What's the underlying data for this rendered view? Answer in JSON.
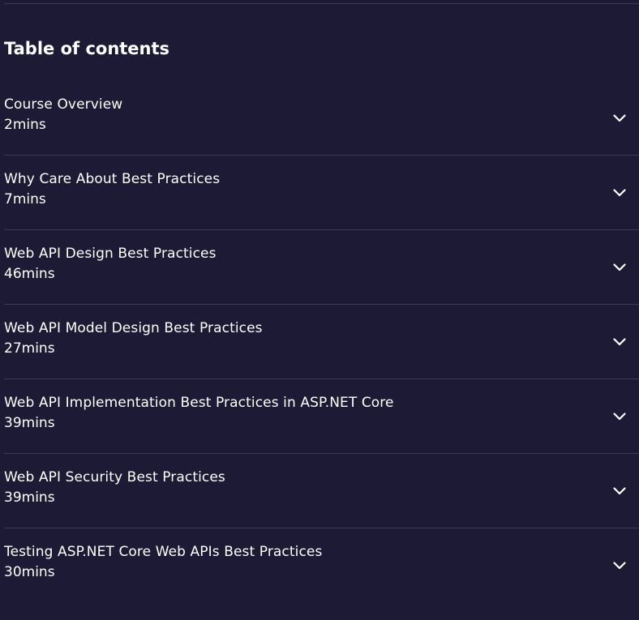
{
  "toc": {
    "title": "Table of contents",
    "items": [
      {
        "title": "Course Overview",
        "duration": "2mins"
      },
      {
        "title": "Why Care About Best Practices",
        "duration": "7mins"
      },
      {
        "title": "Web API Design Best Practices",
        "duration": "46mins"
      },
      {
        "title": "Web API Model Design Best Practices",
        "duration": "27mins"
      },
      {
        "title": "Web API Implementation Best Practices in ASP.NET Core",
        "duration": "39mins"
      },
      {
        "title": "Web API Security Best Practices",
        "duration": "39mins"
      },
      {
        "title": "Testing ASP.NET Core Web APIs Best Practices",
        "duration": "30mins"
      }
    ],
    "expand_icon": "chevron-down-icon"
  },
  "colors": {
    "background": "#1c1a34",
    "divider": "#3a3857",
    "text": "#ffffff"
  }
}
